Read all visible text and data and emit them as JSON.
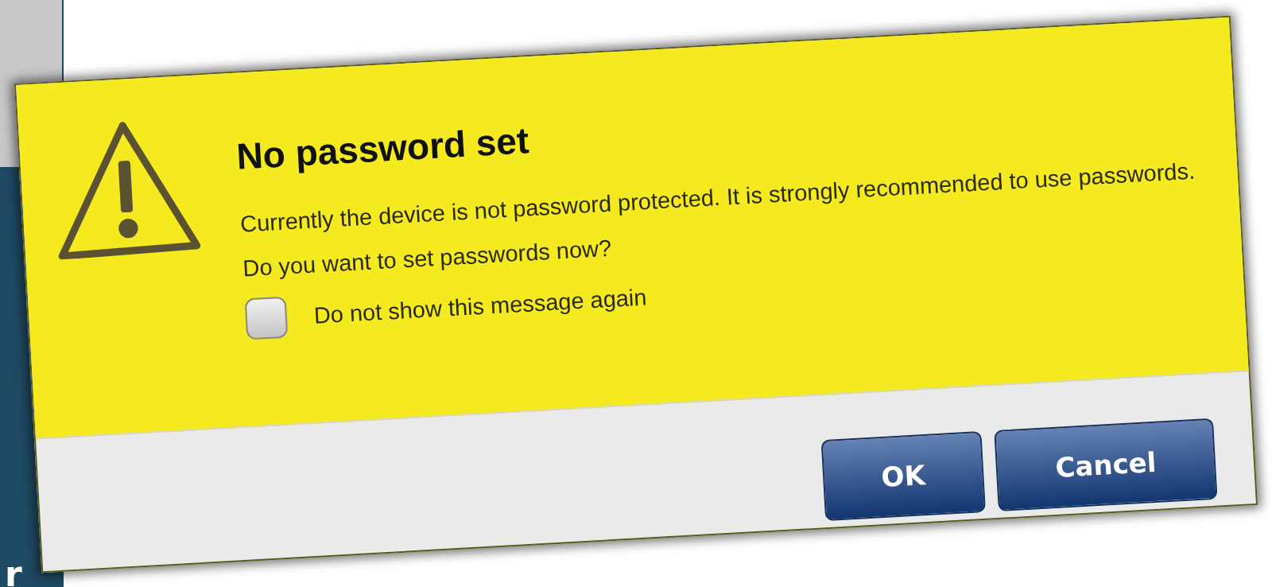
{
  "background": {
    "sidebar_text": "r"
  },
  "dialog": {
    "title": "No password set",
    "message": "Currently the device is not password protected. It is strongly recommended to use passwords. Do you want to set passwords now?",
    "checkbox": {
      "label": "Do not show this message again",
      "checked": false
    },
    "buttons": [
      {
        "label": "OK"
      },
      {
        "label": "Cancel"
      }
    ]
  }
}
